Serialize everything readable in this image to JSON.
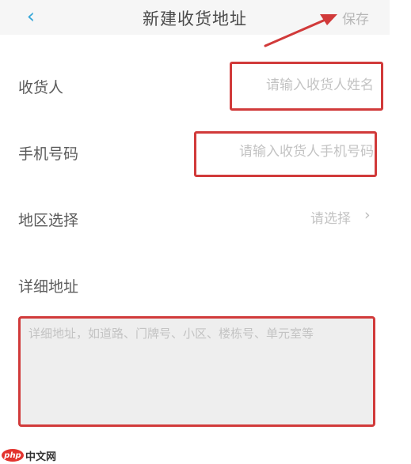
{
  "header": {
    "back_icon": "chevron-left-icon",
    "title": "新建收货地址",
    "save_label": "保存"
  },
  "form": {
    "recipient": {
      "label": "收货人",
      "placeholder": "请输入收货人姓名",
      "value": ""
    },
    "phone": {
      "label": "手机号码",
      "placeholder": "请输入收货人手机号码",
      "value": ""
    },
    "region": {
      "label": "地区选择",
      "value": "请选择",
      "icon": "chevron-right-icon"
    },
    "address": {
      "label": "详细地址",
      "placeholder": "详细地址，如道路、门牌号、小区、楼栋号、单元室等",
      "value": ""
    }
  },
  "annotation": {
    "color": "#d13a3a",
    "arrow_icon": "red-arrow-icon"
  },
  "watermark": {
    "logo": "php",
    "text": "中文网"
  }
}
